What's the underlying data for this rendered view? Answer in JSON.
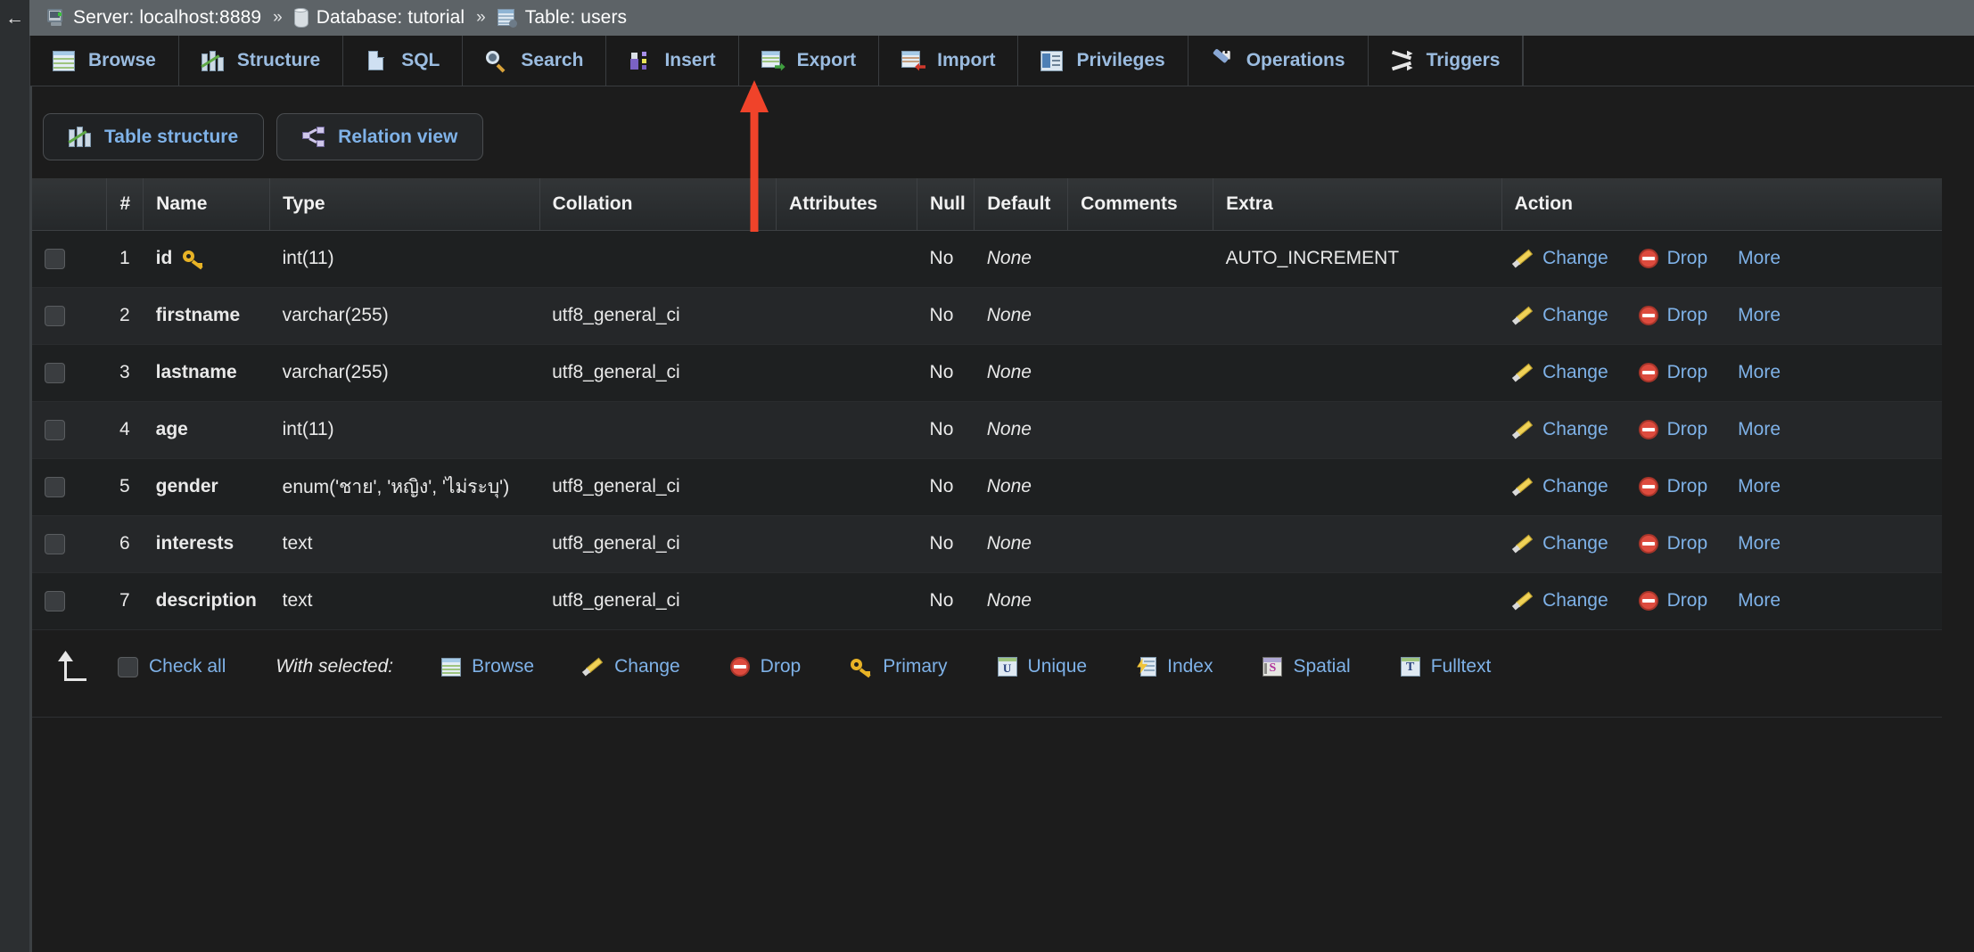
{
  "breadcrumb": {
    "back_label": "←",
    "items": [
      {
        "icon": "server-icon",
        "label": "Server: localhost:8889"
      },
      {
        "icon": "database-icon",
        "label": "Database: tutorial"
      },
      {
        "icon": "table-icon",
        "label": "Table: users"
      }
    ],
    "separator": "»"
  },
  "tabs": [
    {
      "icon": "browse-icon",
      "label": "Browse"
    },
    {
      "icon": "structure-icon",
      "label": "Structure"
    },
    {
      "icon": "sql-icon",
      "label": "SQL"
    },
    {
      "icon": "search-icon",
      "label": "Search"
    },
    {
      "icon": "insert-icon",
      "label": "Insert"
    },
    {
      "icon": "export-icon",
      "label": "Export"
    },
    {
      "icon": "import-icon",
      "label": "Import"
    },
    {
      "icon": "privileges-icon",
      "label": "Privileges"
    },
    {
      "icon": "operations-icon",
      "label": "Operations"
    },
    {
      "icon": "triggers-icon",
      "label": "Triggers"
    }
  ],
  "subtabs": [
    {
      "icon": "structure-icon",
      "label": "Table structure",
      "active": true
    },
    {
      "icon": "relation-icon",
      "label": "Relation view",
      "active": false
    }
  ],
  "table": {
    "headers": [
      "",
      "#",
      "Name",
      "Type",
      "Collation",
      "Attributes",
      "Null",
      "Default",
      "Comments",
      "Extra",
      "Action"
    ],
    "rows": [
      {
        "num": "1",
        "name": "id",
        "primary": true,
        "type": "int(11)",
        "collation": "",
        "attributes": "",
        "null": "No",
        "default": "None",
        "comments": "",
        "extra": "AUTO_INCREMENT"
      },
      {
        "num": "2",
        "name": "firstname",
        "primary": false,
        "type": "varchar(255)",
        "collation": "utf8_general_ci",
        "attributes": "",
        "null": "No",
        "default": "None",
        "comments": "",
        "extra": ""
      },
      {
        "num": "3",
        "name": "lastname",
        "primary": false,
        "type": "varchar(255)",
        "collation": "utf8_general_ci",
        "attributes": "",
        "null": "No",
        "default": "None",
        "comments": "",
        "extra": ""
      },
      {
        "num": "4",
        "name": "age",
        "primary": false,
        "type": "int(11)",
        "collation": "",
        "attributes": "",
        "null": "No",
        "default": "None",
        "comments": "",
        "extra": ""
      },
      {
        "num": "5",
        "name": "gender",
        "primary": false,
        "type": "enum('ชาย', 'หญิง', 'ไม่ระบุ')",
        "collation": "utf8_general_ci",
        "attributes": "",
        "null": "No",
        "default": "None",
        "comments": "",
        "extra": ""
      },
      {
        "num": "6",
        "name": "interests",
        "primary": false,
        "type": "text",
        "collation": "utf8_general_ci",
        "attributes": "",
        "null": "No",
        "default": "None",
        "comments": "",
        "extra": ""
      },
      {
        "num": "7",
        "name": "description",
        "primary": false,
        "type": "text",
        "collation": "utf8_general_ci",
        "attributes": "",
        "null": "No",
        "default": "None",
        "comments": "",
        "extra": ""
      }
    ],
    "row_actions": [
      {
        "icon": "pencil-icon",
        "label": "Change"
      },
      {
        "icon": "drop-icon",
        "label": "Drop"
      },
      {
        "icon": "",
        "label": "More"
      }
    ]
  },
  "bottom_bar": {
    "check_all_label": "Check all",
    "with_selected_label": "With selected:",
    "actions": [
      {
        "icon": "browse-icon",
        "label": "Browse"
      },
      {
        "icon": "pencil-icon",
        "label": "Change"
      },
      {
        "icon": "drop-icon",
        "label": "Drop"
      },
      {
        "icon": "primary-icon",
        "label": "Primary"
      },
      {
        "icon": "unique-icon",
        "label": "Unique"
      },
      {
        "icon": "index-icon",
        "label": "Index"
      },
      {
        "icon": "spatial-icon",
        "label": "Spatial"
      },
      {
        "icon": "fulltext-icon",
        "label": "Fulltext"
      }
    ]
  },
  "annotation": {
    "arrow_color": "#f0432a",
    "points_to": "Insert"
  },
  "colors": {
    "link_blue": "#7fb2e8",
    "breadcrumb_bg": "#5d6367",
    "page_bg": "#1c1c1c",
    "row_odd": "#1e2021",
    "row_even": "#252729",
    "header_text": "#f1f1f1"
  }
}
